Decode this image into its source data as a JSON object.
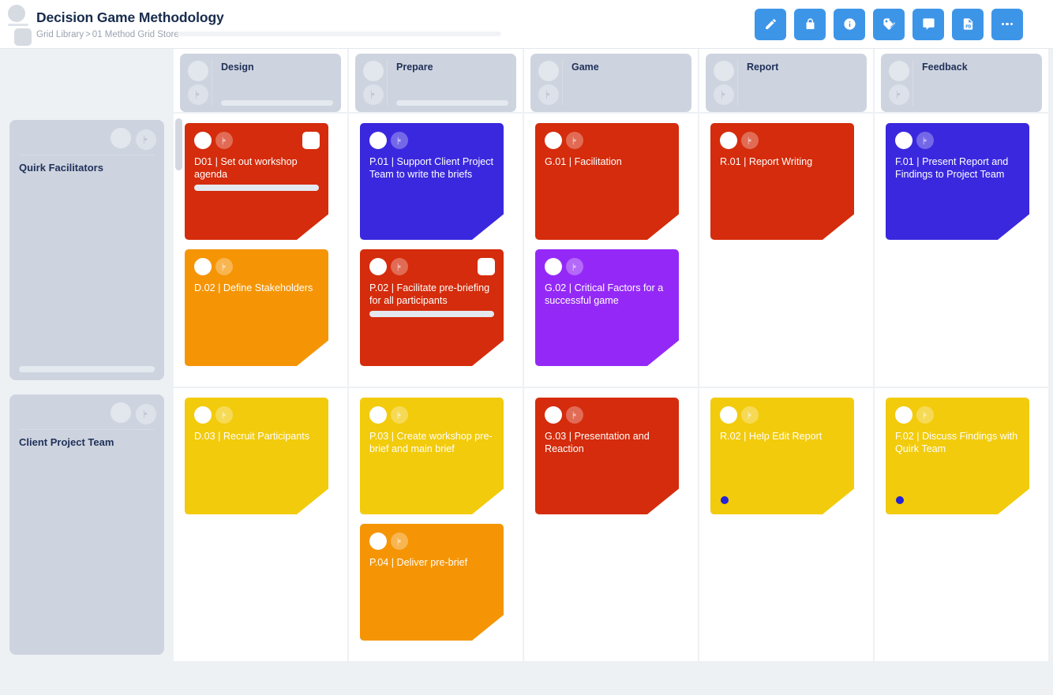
{
  "header": {
    "title": "Decision Game Methodology",
    "breadcrumb": {
      "root": "Grid Library",
      "separator": ">",
      "current": "01 Method Grid Store"
    },
    "accent_color": "#3d95e8",
    "toolbar": [
      {
        "name": "edit-button",
        "icon": "pencil-icon",
        "label": "Edit"
      },
      {
        "name": "lock-button",
        "icon": "lock-icon",
        "label": "Lock"
      },
      {
        "name": "info-button",
        "icon": "info-icon",
        "label": "Info"
      },
      {
        "name": "tags-button",
        "icon": "tag-icon",
        "label": "Tags"
      },
      {
        "name": "comments-button",
        "icon": "comment-icon",
        "label": "Comments"
      },
      {
        "name": "export-pdf-button",
        "icon": "pdf-document-icon",
        "label": "Export PDF"
      },
      {
        "name": "more-button",
        "icon": "ellipsis-icon",
        "label": "More"
      }
    ]
  },
  "board": {
    "columns": [
      {
        "label": "Design",
        "has_progress": true
      },
      {
        "label": "Prepare",
        "has_progress": true
      },
      {
        "label": "Game",
        "has_progress": false
      },
      {
        "label": "Report",
        "has_progress": false
      },
      {
        "label": "Feedback",
        "has_progress": false
      }
    ],
    "rows": [
      {
        "label": "Quirk Facilitators",
        "has_progress": true
      },
      {
        "label": "Client Project Team",
        "has_progress": false
      }
    ],
    "card_colors": {
      "red": "#d42c0c",
      "orange": "#f59505",
      "yellow": "#f2cb0c",
      "blue": "#3a28de",
      "purple": "#9429f7",
      "dot_blue": "#2323d8"
    },
    "cells": [
      {
        "row": "Quirk Facilitators",
        "column": "Design",
        "cards": [
          {
            "title": "D01 | Set out workshop agenda",
            "color": "#d42c0c",
            "note": true,
            "progress": true,
            "dot": false
          },
          {
            "title": "D.02 | Define Stakeholders",
            "color": "#f59505",
            "note": false,
            "progress": false,
            "dot": false
          }
        ]
      },
      {
        "row": "Quirk Facilitators",
        "column": "Prepare",
        "cards": [
          {
            "title": "P.01 | Support Client Project Team to write the briefs",
            "color": "#3a28de",
            "note": false,
            "progress": false,
            "dot": false
          },
          {
            "title": "P.02 | Facilitate pre-briefing for all participants",
            "color": "#d42c0c",
            "note": true,
            "progress": true,
            "dot": false
          }
        ]
      },
      {
        "row": "Quirk Facilitators",
        "column": "Game",
        "cards": [
          {
            "title": "G.01 | Facilitation",
            "color": "#d42c0c",
            "note": false,
            "progress": false,
            "dot": false
          },
          {
            "title": "G.02 | Critical Factors for a successful game",
            "color": "#9429f7",
            "note": false,
            "progress": false,
            "dot": false
          }
        ]
      },
      {
        "row": "Quirk Facilitators",
        "column": "Report",
        "cards": [
          {
            "title": "R.01 | Report Writing",
            "color": "#d42c0c",
            "note": false,
            "progress": false,
            "dot": false
          }
        ]
      },
      {
        "row": "Quirk Facilitators",
        "column": "Feedback",
        "cards": [
          {
            "title": "F.01 | Present Report and Findings to Project Team",
            "color": "#3a28de",
            "note": false,
            "progress": false,
            "dot": false
          }
        ]
      },
      {
        "row": "Client Project Team",
        "column": "Design",
        "cards": [
          {
            "title": "D.03 | Recruit Participants",
            "color": "#f2cb0c",
            "note": false,
            "progress": false,
            "dot": false
          }
        ]
      },
      {
        "row": "Client Project Team",
        "column": "Prepare",
        "cards": [
          {
            "title": "P.03 | Create workshop pre-brief and main brief",
            "color": "#f2cb0c",
            "note": false,
            "progress": false,
            "dot": false
          },
          {
            "title": "P.04 | Deliver pre-brief",
            "color": "#f59505",
            "note": false,
            "progress": false,
            "dot": false
          }
        ]
      },
      {
        "row": "Client Project Team",
        "column": "Game",
        "cards": [
          {
            "title": "G.03 | Presentation and Reaction",
            "color": "#d42c0c",
            "note": false,
            "progress": false,
            "dot": false
          }
        ]
      },
      {
        "row": "Client Project Team",
        "column": "Report",
        "cards": [
          {
            "title": "R.02 | Help Edit Report",
            "color": "#f2cb0c",
            "note": false,
            "progress": false,
            "dot": true
          }
        ]
      },
      {
        "row": "Client Project Team",
        "column": "Feedback",
        "cards": [
          {
            "title": "F.02 | Discuss Findings with Quirk Team",
            "color": "#f2cb0c",
            "note": false,
            "progress": false,
            "dot": true
          }
        ]
      }
    ]
  }
}
